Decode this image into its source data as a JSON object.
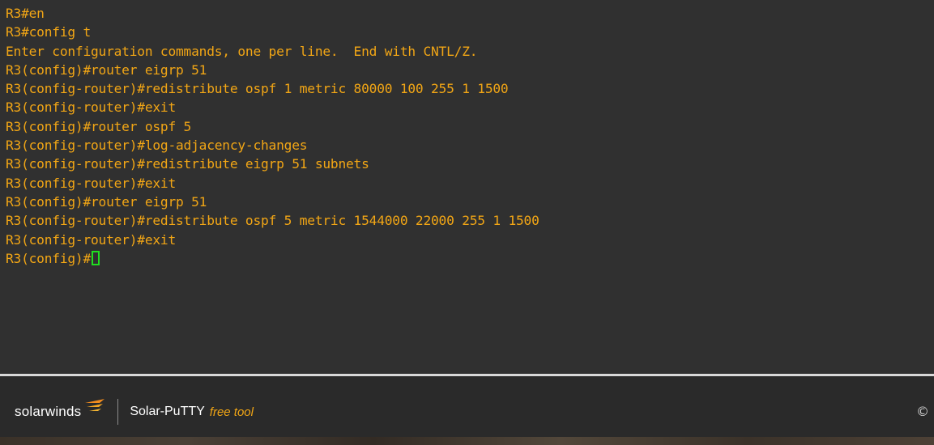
{
  "terminal": {
    "lines": [
      "R3#en",
      "R3#config t",
      "Enter configuration commands, one per line.  End with CNTL/Z.",
      "R3(config)#router eigrp 51",
      "R3(config-router)#redistribute ospf 1 metric 80000 100 255 1 1500",
      "R3(config-router)#exit",
      "R3(config)#router ospf 5",
      "R3(config-router)#log-adjacency-changes",
      "R3(config-router)#redistribute eigrp 51 subnets",
      "R3(config-router)#exit",
      "R3(config)#router eigrp 51",
      "R3(config-router)#redistribute ospf 5 metric 1544000 22000 255 1 1500",
      "R3(config-router)#exit"
    ],
    "prompt": "R3(config)#",
    "text_color": "#f2a615",
    "cursor_color": "#20e020",
    "background": "#303030"
  },
  "footer": {
    "brand": "solarwinds",
    "brand_icon": "solarwinds-logo-icon",
    "product": "Solar-PuTTY",
    "free_tool": "free tool",
    "copyright": "©"
  }
}
